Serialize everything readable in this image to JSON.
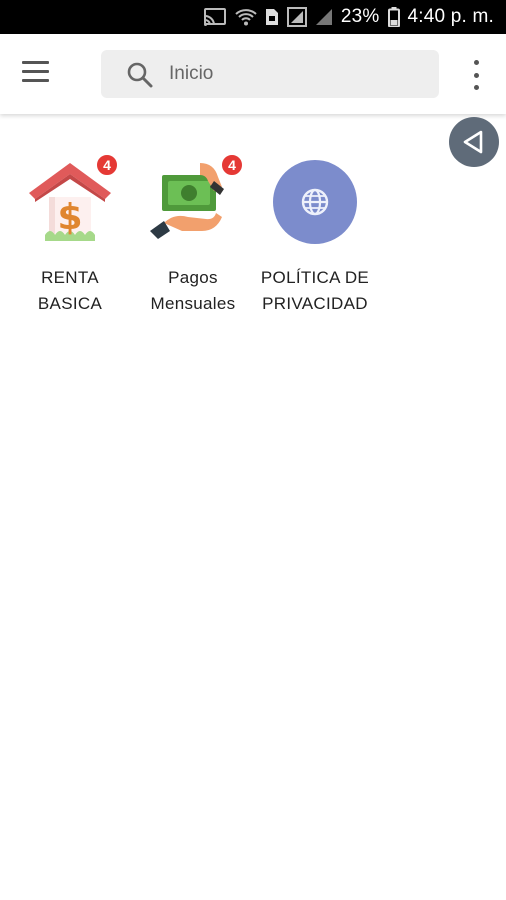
{
  "status_bar": {
    "battery": "23%",
    "time": "4:40 p. m."
  },
  "app_bar": {
    "search_placeholder": "Inicio"
  },
  "tiles": [
    {
      "label_line1": "RENTA",
      "label_line2": "BASICA",
      "badge": "4"
    },
    {
      "label_line1": "Pagos",
      "label_line2": "Mensuales",
      "badge": "4"
    },
    {
      "label_line1": "POLÍTICA DE",
      "label_line2": "PRIVACIDAD",
      "badge": ""
    }
  ],
  "colors": {
    "badge": "#e53935",
    "globe_circle": "#7c8ccc",
    "back_fab": "#5f6b79",
    "house_roof": "#e05a5a",
    "dollar": "#e0862f"
  }
}
